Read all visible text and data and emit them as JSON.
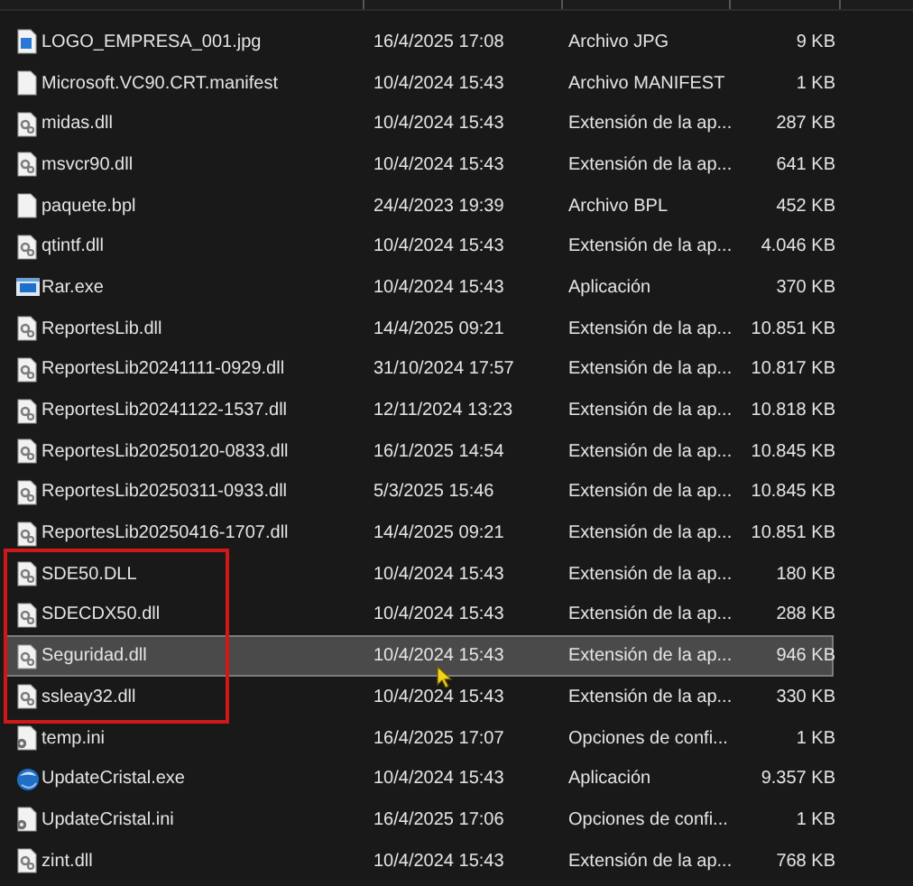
{
  "files": [
    {
      "name": "LOGO_EMPRESA_001.jpg",
      "modified": "16/4/2025 17:08",
      "type": "Archivo JPG",
      "size": "9 KB",
      "kind": "image",
      "selected": false,
      "outlined": false
    },
    {
      "name": "Microsoft.VC90.CRT.manifest",
      "modified": "10/4/2024 15:43",
      "type": "Archivo MANIFEST",
      "size": "1 KB",
      "kind": "blank",
      "selected": false,
      "outlined": false
    },
    {
      "name": "midas.dll",
      "modified": "10/4/2024 15:43",
      "type": "Extensión de la ap...",
      "size": "287 KB",
      "kind": "dll",
      "selected": false,
      "outlined": false
    },
    {
      "name": "msvcr90.dll",
      "modified": "10/4/2024 15:43",
      "type": "Extensión de la ap...",
      "size": "641 KB",
      "kind": "dll",
      "selected": false,
      "outlined": false
    },
    {
      "name": "paquete.bpl",
      "modified": "24/4/2023 19:39",
      "type": "Archivo BPL",
      "size": "452 KB",
      "kind": "blank",
      "selected": false,
      "outlined": false
    },
    {
      "name": "qtintf.dll",
      "modified": "10/4/2024 15:43",
      "type": "Extensión de la ap...",
      "size": "4.046 KB",
      "kind": "dll",
      "selected": false,
      "outlined": false
    },
    {
      "name": "Rar.exe",
      "modified": "10/4/2024 15:43",
      "type": "Aplicación",
      "size": "370 KB",
      "kind": "exe",
      "selected": false,
      "outlined": false
    },
    {
      "name": "ReportesLib.dll",
      "modified": "14/4/2025 09:21",
      "type": "Extensión de la ap...",
      "size": "10.851 KB",
      "kind": "dll",
      "selected": false,
      "outlined": false
    },
    {
      "name": "ReportesLib20241111-0929.dll",
      "modified": "31/10/2024 17:57",
      "type": "Extensión de la ap...",
      "size": "10.817 KB",
      "kind": "dll",
      "selected": false,
      "outlined": false
    },
    {
      "name": "ReportesLib20241122-1537.dll",
      "modified": "12/11/2024 13:23",
      "type": "Extensión de la ap...",
      "size": "10.818 KB",
      "kind": "dll",
      "selected": false,
      "outlined": false
    },
    {
      "name": "ReportesLib20250120-0833.dll",
      "modified": "16/1/2025 14:54",
      "type": "Extensión de la ap...",
      "size": "10.845 KB",
      "kind": "dll",
      "selected": false,
      "outlined": false
    },
    {
      "name": "ReportesLib20250311-0933.dll",
      "modified": "5/3/2025 15:46",
      "type": "Extensión de la ap...",
      "size": "10.845 KB",
      "kind": "dll",
      "selected": false,
      "outlined": false
    },
    {
      "name": "ReportesLib20250416-1707.dll",
      "modified": "14/4/2025 09:21",
      "type": "Extensión de la ap...",
      "size": "10.851 KB",
      "kind": "dll",
      "selected": false,
      "outlined": false
    },
    {
      "name": "SDE50.DLL",
      "modified": "10/4/2024 15:43",
      "type": "Extensión de la ap...",
      "size": "180 KB",
      "kind": "dll",
      "selected": false,
      "outlined": true
    },
    {
      "name": "SDECDX50.dll",
      "modified": "10/4/2024 15:43",
      "type": "Extensión de la ap...",
      "size": "288 KB",
      "kind": "dll",
      "selected": false,
      "outlined": true
    },
    {
      "name": "Seguridad.dll",
      "modified": "10/4/2024 15:43",
      "type": "Extensión de la ap...",
      "size": "946 KB",
      "kind": "dll",
      "selected": true,
      "outlined": true
    },
    {
      "name": "ssleay32.dll",
      "modified": "10/4/2024 15:43",
      "type": "Extensión de la ap...",
      "size": "330 KB",
      "kind": "dll",
      "selected": false,
      "outlined": true
    },
    {
      "name": "temp.ini",
      "modified": "16/4/2025 17:07",
      "type": "Opciones de confi...",
      "size": "1 KB",
      "kind": "ini",
      "selected": false,
      "outlined": false
    },
    {
      "name": "UpdateCristal.exe",
      "modified": "10/4/2024 15:43",
      "type": "Aplicación",
      "size": "9.357 KB",
      "kind": "globe",
      "selected": false,
      "outlined": false
    },
    {
      "name": "UpdateCristal.ini",
      "modified": "16/4/2025 17:06",
      "type": "Opciones de confi...",
      "size": "1 KB",
      "kind": "ini",
      "selected": false,
      "outlined": false
    },
    {
      "name": "zint.dll",
      "modified": "10/4/2024 15:43",
      "type": "Extensión de la ap...",
      "size": "768 KB",
      "kind": "dll",
      "selected": false,
      "outlined": false
    }
  ]
}
